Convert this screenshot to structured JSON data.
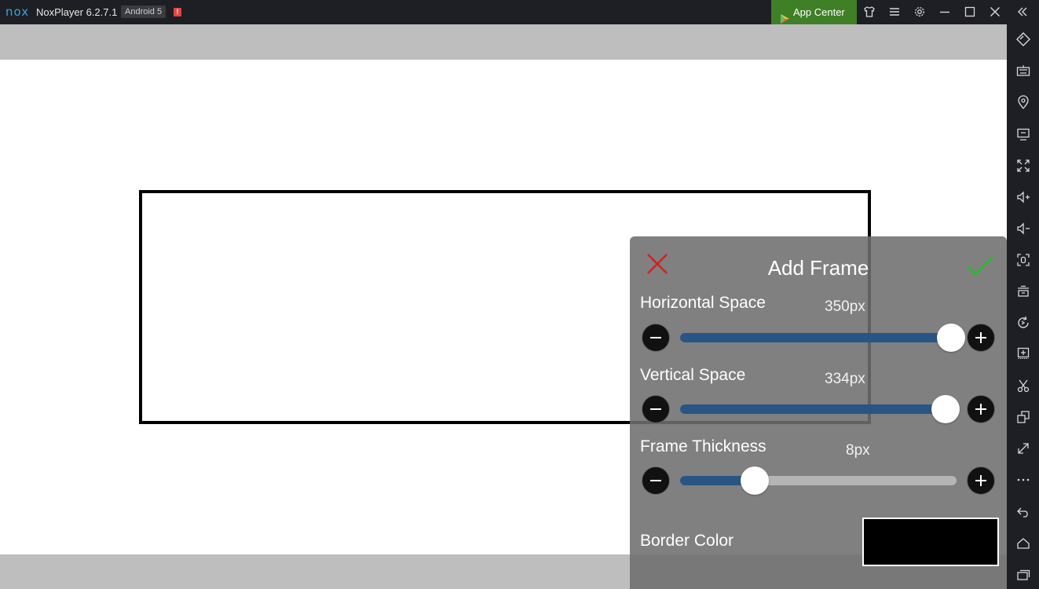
{
  "titlebar": {
    "logo": "nox",
    "app_name": "NoxPlayer 6.2.7.1",
    "android_badge": "Android 5",
    "alert_badge": "!",
    "app_center": "App Center",
    "icons": [
      "shirt-icon",
      "menu-icon",
      "gear-icon",
      "minimize-icon",
      "maximize-icon",
      "close-icon",
      "collapse-sidebar-icon"
    ]
  },
  "sidebar": {
    "icons": [
      "rotate-screen-icon",
      "keyboard-icon",
      "location-icon",
      "screen-icon",
      "fullscreen-icon",
      "volume-up-icon",
      "volume-down-icon",
      "screenshot-icon",
      "toolbox-icon",
      "sync-icon",
      "apk-install-icon",
      "cut-icon",
      "multi-instance-icon",
      "resize-icon",
      "more-icon",
      "back-icon",
      "home-icon",
      "recent-apps-icon"
    ]
  },
  "panel": {
    "title": "Add Frame",
    "rows": [
      {
        "label": "Horizontal Space",
        "value": "350px",
        "level": 0.98
      },
      {
        "label": "Vertical Space",
        "value": "334px",
        "level": 0.96
      },
      {
        "label": "Frame Thickness",
        "value": "8px",
        "level": 0.27
      }
    ],
    "border_color_label": "Border Color",
    "border_color": "#000000"
  },
  "colors": {
    "titlebar_bg": "#1e1f24",
    "app_center_bg": "#3f7f26",
    "panel_bg": "#6e6e6e",
    "slider_fill": "#285584",
    "slider_track": "#b5b5b5",
    "close_red": "#d32020",
    "check_green": "#2fb52f"
  }
}
